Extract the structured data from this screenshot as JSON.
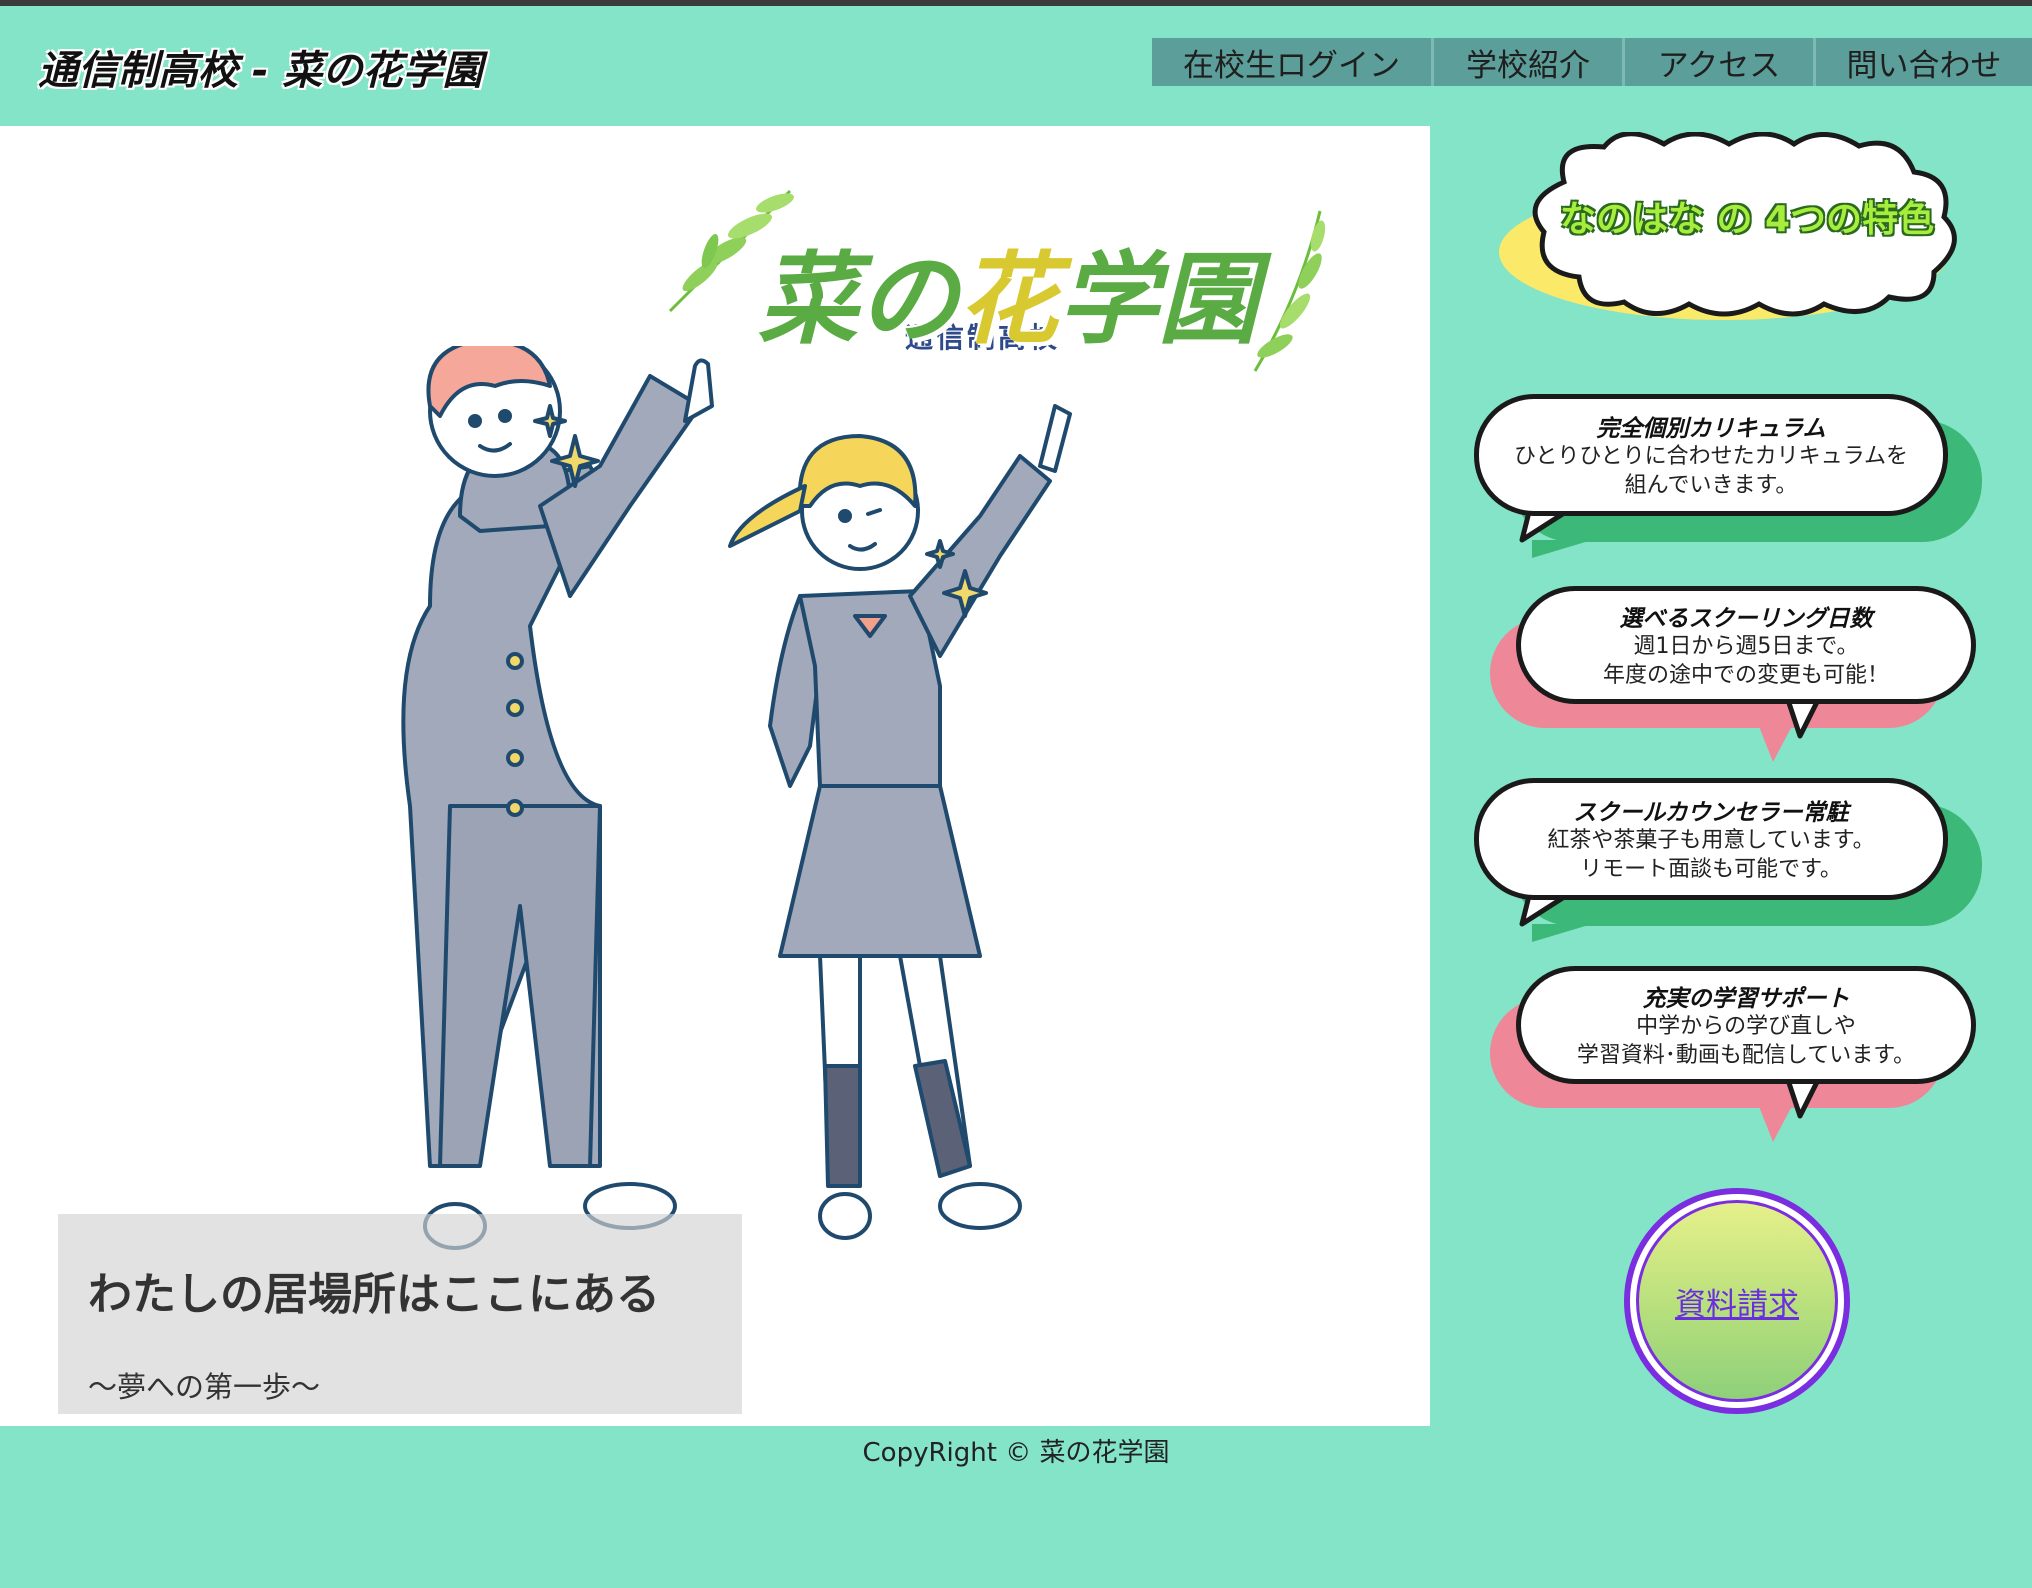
{
  "header": {
    "site_title": "通信制高校 - 菜の花学園",
    "nav": [
      {
        "label": "在校生ログイン"
      },
      {
        "label": "学校紹介"
      },
      {
        "label": "アクセス"
      },
      {
        "label": "問い合わせ"
      }
    ]
  },
  "hero": {
    "logo_sub": "通信制高校",
    "logo_main_1": "菜の",
    "logo_main_2": "花",
    "logo_main_3": "学園",
    "catch_title": "わたしの居場所はここにある",
    "catch_sub": "～夢への第一歩～"
  },
  "features": {
    "title": "なのはな の 4つの特色",
    "items": [
      {
        "title": "完全個別カリキュラム",
        "line1": "ひとりひとりに合わせたカリキュラムを",
        "line2": "組んでいきます。"
      },
      {
        "title": "選べるスクーリング日数",
        "line1": "週1日から週5日まで。",
        "line2": "年度の途中での変更も可能！"
      },
      {
        "title": "スクールカウンセラー常駐",
        "line1": "紅茶や茶菓子も用意しています。",
        "line2": "リモート面談も可能です。"
      },
      {
        "title": "充実の学習サポート",
        "line1": "中学からの学び直しや",
        "line2": "学習資料･動画も配信しています。"
      }
    ]
  },
  "cta": {
    "label": "資料請求"
  },
  "footer": {
    "copyright": "CopyRight © 菜の花学園"
  },
  "colors": {
    "page_bg": "#84e4c8",
    "nav_bg": "#5c9e9a",
    "bubble_shadow_green": "#3cb878",
    "bubble_shadow_pink": "#ee8898",
    "cta_border": "#7a2ee0"
  }
}
